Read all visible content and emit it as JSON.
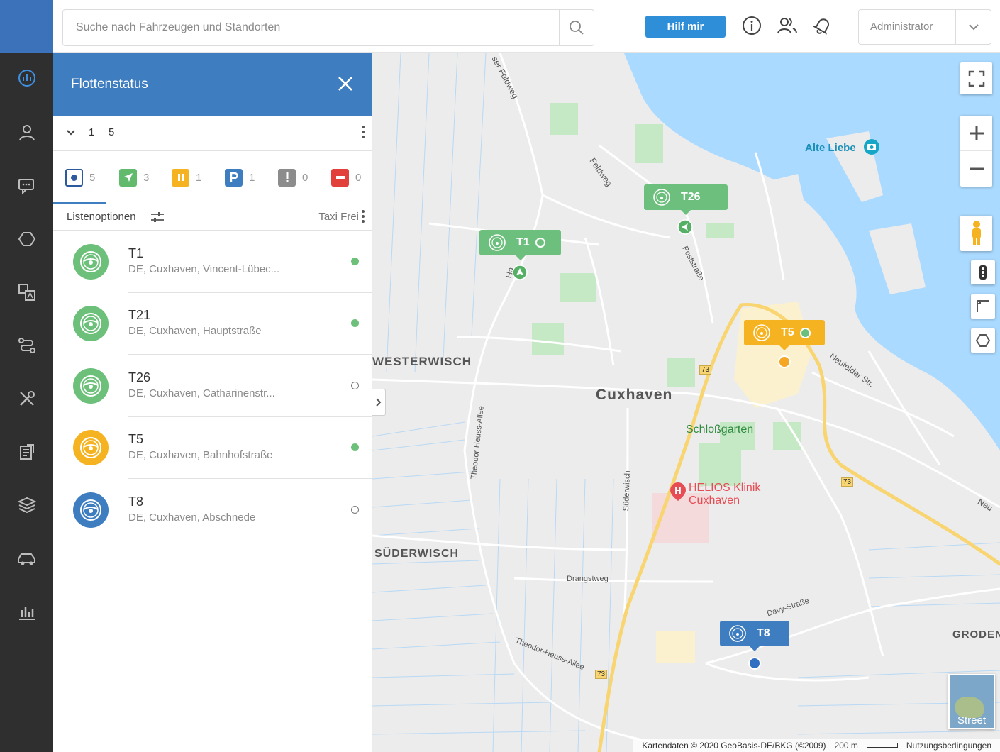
{
  "search": {
    "placeholder": "Suche nach Fahrzeugen und Standorten"
  },
  "header": {
    "help_label": "Hilf mir",
    "user_label": "Administrator"
  },
  "panel": {
    "title": "Flottenstatus",
    "group": {
      "first": "1",
      "second": "5"
    },
    "statuses": [
      {
        "icon": "all-circle-icon",
        "count": "5",
        "color": "#2d5a9e"
      },
      {
        "icon": "navigation-arrow-icon",
        "count": "3",
        "color": "#62ba6d"
      },
      {
        "icon": "pause-icon",
        "count": "1",
        "color": "#f5b321"
      },
      {
        "icon": "parking-icon",
        "count": "1",
        "color": "#3e7dc0"
      },
      {
        "icon": "exclamation-icon",
        "count": "0",
        "color": "#8c8c8c"
      },
      {
        "icon": "no-entry-icon",
        "count": "0",
        "color": "#e2413b"
      }
    ],
    "list_options_label": "Listenoptionen",
    "sort_label": "Taxi Frei",
    "vehicles": [
      {
        "name": "T1",
        "address": "DE, Cuxhaven, Vincent-Lübec...",
        "color": "#6cc07a",
        "dot": "filled"
      },
      {
        "name": "T21",
        "address": "DE, Cuxhaven, Hauptstraße",
        "color": "#6cc07a",
        "dot": "filled"
      },
      {
        "name": "T26",
        "address": "DE, Cuxhaven, Catharinenstr...",
        "color": "#6cc07a",
        "dot": "empty"
      },
      {
        "name": "T5",
        "address": "DE, Cuxhaven, Bahnhofstraße",
        "color": "#f5b321",
        "dot": "filled"
      },
      {
        "name": "T8",
        "address": "DE, Cuxhaven, Abschnede",
        "color": "#3e7dc0",
        "dot": "empty"
      }
    ]
  },
  "map": {
    "labels": {
      "alte_liebe": "Alte Liebe",
      "westerwisch": "WESTERWISCH",
      "cuxhaven": "Cuxhaven",
      "schlossgarten": "Schloßgarten",
      "helios1": "HELIOS Klinik",
      "helios2": "Cuxhaven",
      "suederwisch": "SÜDERWISCH",
      "groden": "GRODEN",
      "feldweg": "Feldweg",
      "postsstrasse": "Poststraße",
      "neufelder": "Neufelder Str.",
      "theodor1": "Theodor-Heuss-Allee",
      "theodor2": "Theodor-Heuss-Allee",
      "suederwisch_str": "Süderwisch",
      "drangstweg": "Drangstweg",
      "davy": "Davy-Straße",
      "road73a": "73",
      "road73b": "73",
      "road73c": "73",
      "street": "Street",
      "neu": "Neu",
      "ha": "Ha",
      "ser_feldweg": "ser Feldweg"
    },
    "pins": {
      "t26": "T26",
      "t1": "T1",
      "t5": "T5",
      "t8": "T8"
    },
    "footer": {
      "data": "Kartendaten © 2020 GeoBasis-DE/BKG (©2009)",
      "scale": "200 m",
      "terms": "Nutzungsbedingungen"
    },
    "colors": {
      "water": "#aadaff",
      "park": "#c5e8c5",
      "road_major": "#f8d571"
    }
  }
}
